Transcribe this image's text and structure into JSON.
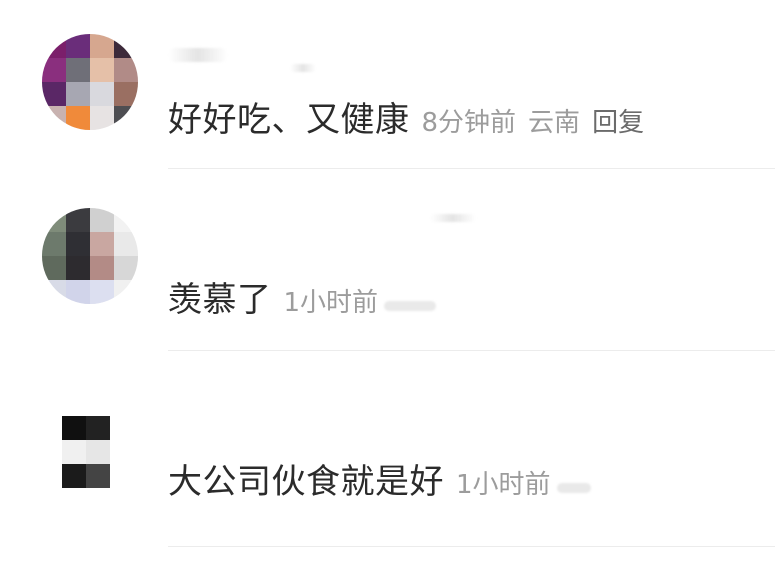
{
  "comments": [
    {
      "text": "好好吃、又健康",
      "time": "8分钟前",
      "location": "云南",
      "reply": "回复"
    },
    {
      "text": "羡慕了",
      "time": "1小时前"
    },
    {
      "text": "大公司伙食就是好",
      "time": "1小时前"
    }
  ],
  "icons": {
    "avatar": "avatar-icon"
  }
}
